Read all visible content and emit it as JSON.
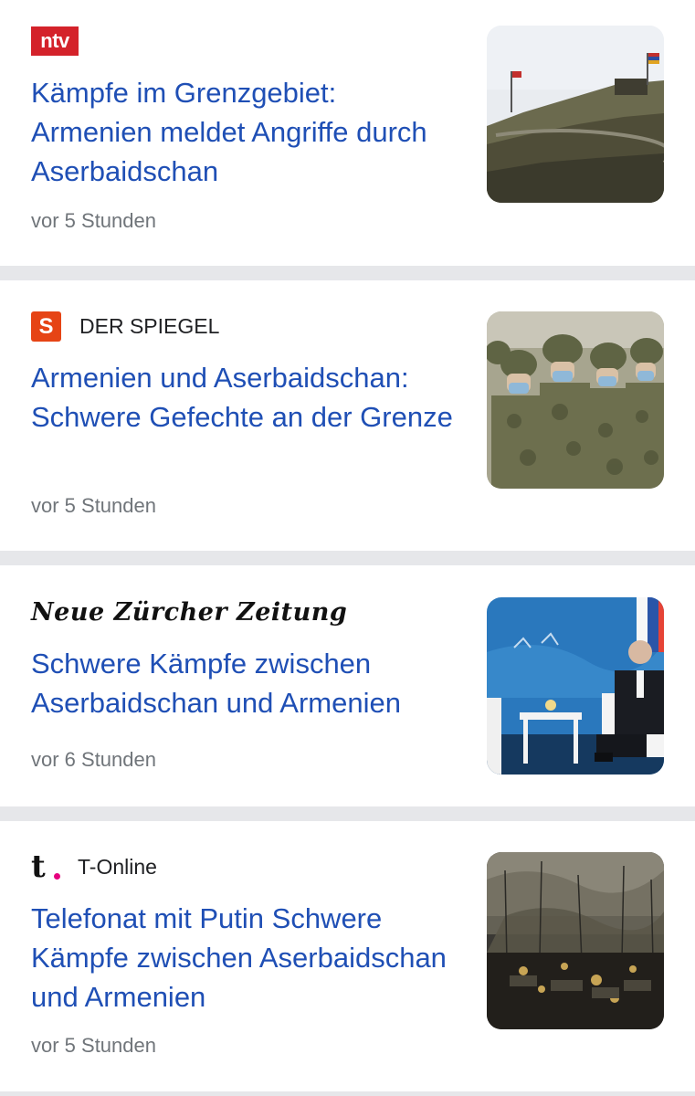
{
  "articles": [
    {
      "source": "ntv",
      "logo_text": "ntv",
      "headline": "Kämpfe im Grenzgebiet: Armenien meldet Angriffe durch Aserbaidschan",
      "time": "vor 5 Stunden",
      "thumbnail": "hillside-border-post-image"
    },
    {
      "source": "DER SPIEGEL",
      "logo_text": "S",
      "headline": "Armenien und Aserbaidschan: Schwere Gefechte an der Grenze",
      "time": "vor 5 Stunden",
      "thumbnail": "soldiers-in-masks-image"
    },
    {
      "source": "Neue Zürcher Zeitung",
      "logo_text": "Neue Zürcher Zeitung",
      "headline": "Schwere Kämpfe zwischen Aserbaidschan und Armenien",
      "time": "vor 6 Stunden",
      "thumbnail": "meeting-room-image"
    },
    {
      "source": "T-Online",
      "logo_text": "t",
      "headline": "Telefonat mit Putin Schwere Kämpfe zwischen Aserbaidschan und Armenien",
      "time": "vor 5 Stunden",
      "thumbnail": "smoke-battlefield-image"
    }
  ],
  "colors": {
    "headline": "#1f4fb5",
    "timestamp": "#70757a",
    "separator": "#e6e7ea",
    "ntv_red": "#d4222a",
    "spiegel_orange": "#e64415",
    "tonline_pink": "#e6007e"
  }
}
